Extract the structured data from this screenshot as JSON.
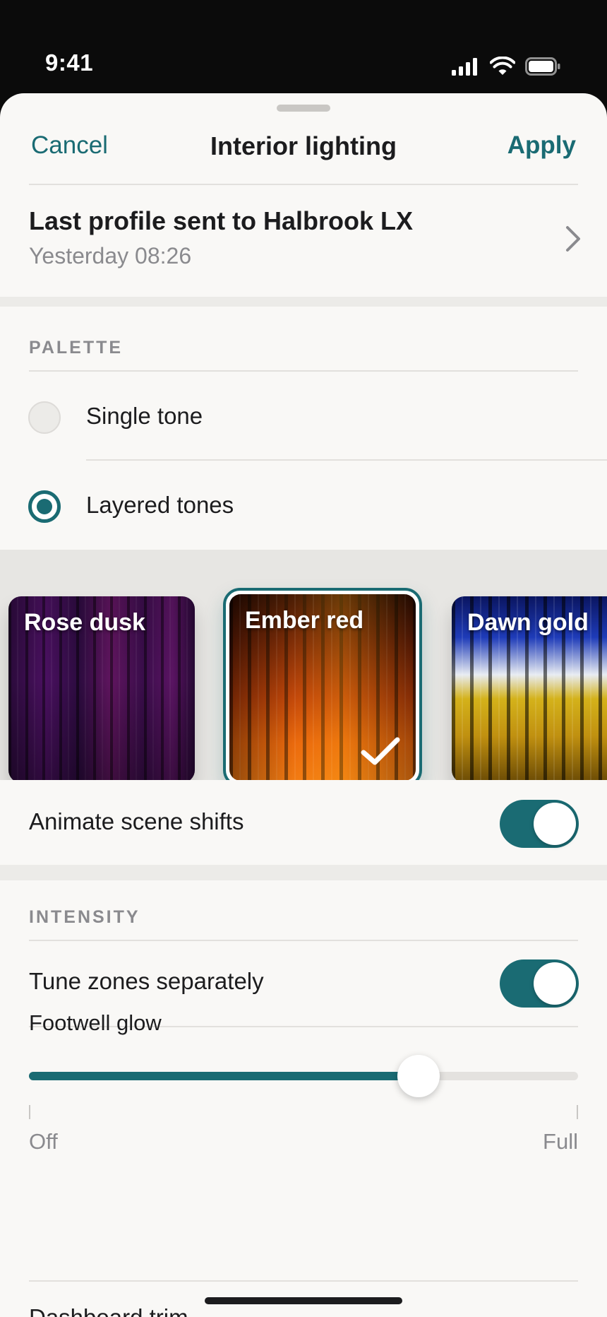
{
  "status_bar": {
    "time": "9:41"
  },
  "nav": {
    "cancel": "Cancel",
    "title": "Interior lighting",
    "apply": "Apply"
  },
  "profile": {
    "title": "Last profile sent to Halbrook LX",
    "subtitle": "Yesterday 08:26"
  },
  "palette": {
    "section_label": "PALETTE",
    "options": [
      {
        "label": "Single tone",
        "selected": false
      },
      {
        "label": "Layered tones",
        "selected": true
      }
    ],
    "swatches": [
      {
        "name": "Rose dusk",
        "selected": false
      },
      {
        "name": "Ember red",
        "selected": true
      },
      {
        "name": "Dawn gold",
        "selected": false
      }
    ],
    "animate": {
      "label": "Animate scene shifts",
      "on": true
    }
  },
  "intensity": {
    "section_label": "INTENSITY",
    "tune_separately": {
      "label": "Tune zones separately",
      "on": true
    },
    "footwell": {
      "label": "Footwell glow",
      "min_label": "Off",
      "max_label": "Full",
      "value": 0.71
    },
    "next_row_label": "Dashboard trim"
  },
  "colors": {
    "accent": "#1a6b73"
  }
}
